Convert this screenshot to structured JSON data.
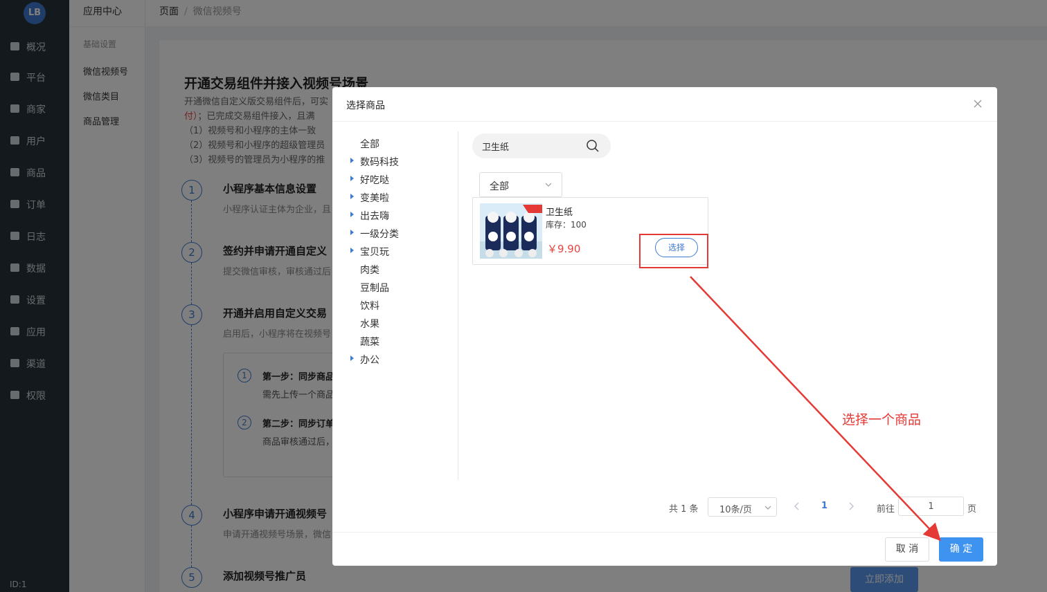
{
  "nav": {
    "logo": "LB",
    "items": [
      {
        "label": "概况",
        "icon": "dashboard-icon"
      },
      {
        "label": "平台",
        "icon": "monitor-icon"
      },
      {
        "label": "商家",
        "icon": "store-icon"
      },
      {
        "label": "用户",
        "icon": "user-icon"
      },
      {
        "label": "商品",
        "icon": "goods-icon"
      },
      {
        "label": "订单",
        "icon": "order-icon"
      },
      {
        "label": "日志",
        "icon": "log-icon"
      },
      {
        "label": "数据",
        "icon": "chart-icon"
      },
      {
        "label": "设置",
        "icon": "gear-icon"
      },
      {
        "label": "应用",
        "icon": "apps-icon"
      },
      {
        "label": "渠道",
        "icon": "cube-icon"
      },
      {
        "label": "权限",
        "icon": "lock-icon"
      }
    ],
    "user_id": "ID:1"
  },
  "subnav": {
    "title": "应用中心",
    "group": "基础设置",
    "links": [
      "微信视频号",
      "微信类目",
      "商品管理"
    ]
  },
  "breadcrumb": {
    "root": "页面",
    "sep": "/",
    "current": "微信视频号"
  },
  "page": {
    "title": "开通交易组件并接入视频号场景",
    "desc1": "开通微信自定义版交易组件后，可实",
    "desc2_red": "付）",
    "desc2": "；已完成交易组件接入，且满",
    "req1": "（1）视频号和小程序的主体一致",
    "req2": "（2）视频号和小程序的超级管理员",
    "req3": "（3）视频号的管理员为小程序的推",
    "steps": [
      {
        "num": "1",
        "title": "小程序基本信息设置",
        "desc": "小程序认证主体为企业，且"
      },
      {
        "num": "2",
        "title": "签约并申请开通自定义",
        "desc": "提交微信审核，审核通过后"
      },
      {
        "num": "3",
        "title": "开通并启用自定义交易",
        "desc": "启用后，小程序将在视频号"
      },
      {
        "num": "4",
        "title": "小程序申请开通视频号",
        "desc": "申请开通视频号场景，微信"
      },
      {
        "num": "5",
        "title": "添加视频号推广员",
        "desc": ""
      }
    ],
    "substeps": [
      {
        "num": "1",
        "title": "第一步：同步商品",
        "desc": "需先上传一个商品"
      },
      {
        "num": "2",
        "title": "第二步：同步订单",
        "desc": "商品审核通过后，"
      }
    ],
    "add_button": "立即添加"
  },
  "modal": {
    "title": "选择商品",
    "categories": [
      {
        "label": "全部",
        "expandable": false
      },
      {
        "label": "数码科技",
        "expandable": true
      },
      {
        "label": "好吃哒",
        "expandable": true
      },
      {
        "label": "变美啦",
        "expandable": true
      },
      {
        "label": "出去嗨",
        "expandable": true
      },
      {
        "label": "一级分类",
        "expandable": true
      },
      {
        "label": "宝贝玩",
        "expandable": true
      },
      {
        "label": "肉类",
        "expandable": false
      },
      {
        "label": "豆制品",
        "expandable": false
      },
      {
        "label": "饮料",
        "expandable": false
      },
      {
        "label": "水果",
        "expandable": false
      },
      {
        "label": "蔬菜",
        "expandable": false
      },
      {
        "label": "办公",
        "expandable": true
      }
    ],
    "search": {
      "value": "卫生纸"
    },
    "filter": {
      "selected": "全部"
    },
    "goods": [
      {
        "name": "卫生纸",
        "stock": "库存：100",
        "price": "￥9.90",
        "select_label": "选择"
      }
    ],
    "pagination": {
      "total": "共 1 条",
      "page_size": "10条/页",
      "current": "1",
      "goto_label": "前往",
      "goto_value": "1",
      "unit": "页"
    },
    "cancel_label": "取 消",
    "ok_label": "确 定"
  },
  "annotation": {
    "text": "选择一个商品",
    "color": "#e53935"
  },
  "colors": {
    "primary": "#3f7ad1",
    "button": "#3f93f0",
    "price": "#e64340",
    "nav_bg": "#263238"
  }
}
